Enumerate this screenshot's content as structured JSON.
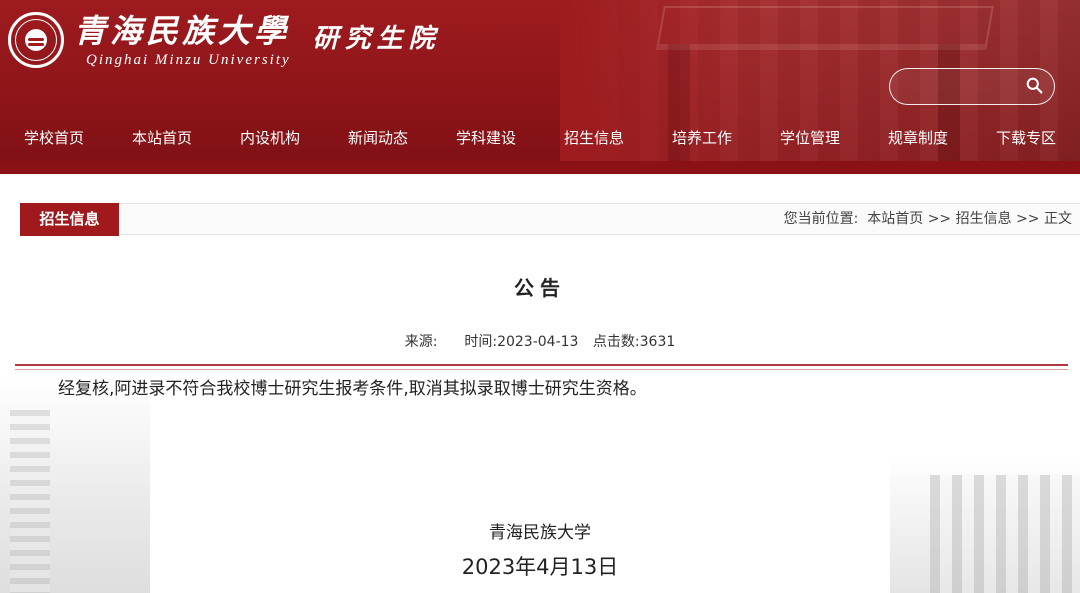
{
  "header": {
    "school_name_cn": "青海民族大學",
    "school_name_en": "Qinghai Minzu University",
    "department": "研究生院",
    "search": {
      "placeholder": "",
      "value": ""
    }
  },
  "nav": {
    "items": [
      {
        "label": "学校首页"
      },
      {
        "label": "本站首页"
      },
      {
        "label": "内设机构"
      },
      {
        "label": "新闻动态"
      },
      {
        "label": "学科建设"
      },
      {
        "label": "招生信息"
      },
      {
        "label": "培养工作"
      },
      {
        "label": "学位管理"
      },
      {
        "label": "规章制度"
      },
      {
        "label": "下载专区"
      }
    ]
  },
  "section": {
    "label": "招生信息",
    "breadcrumb": {
      "prefix": "您当前位置:",
      "items": [
        "本站首页",
        "招生信息",
        "正文"
      ],
      "separator": ">>"
    }
  },
  "article": {
    "title": "公告",
    "source_label": "来源:",
    "source_value": "",
    "time_label": "时间:",
    "time_value": "2023-04-13",
    "views_label": "点击数:",
    "views_value": "3631",
    "body": "经复核,阿进录不符合我校博士研究生报考条件,取消其拟录取博士研究生资格。",
    "signature": "青海民族大学",
    "date": "2023年4月13日"
  },
  "colors": {
    "brand_red": "#9e1b1f",
    "tab_red": "#a0191d",
    "rule_red": "#b23a3e"
  }
}
